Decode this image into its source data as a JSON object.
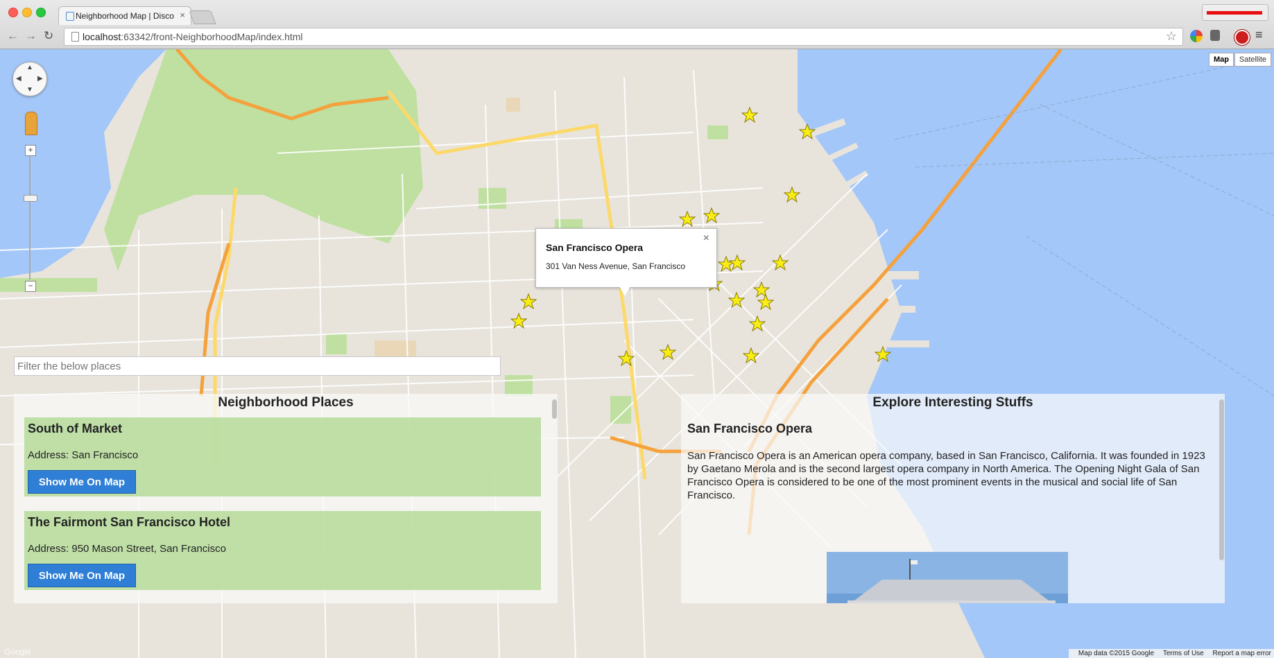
{
  "browser": {
    "tab_title": "Neighborhood Map | Disco",
    "tab_close": "×",
    "url_host": "localhost",
    "url_rest": ":63342/front-NeighborhoodMap/index.html",
    "back": "←",
    "forward": "→",
    "reload": "↻",
    "bookmark_star": "☆"
  },
  "map": {
    "type_map_label": "Map",
    "type_satellite_label": "Satellite",
    "zoom_in": "+",
    "zoom_out": "−",
    "google_logo": "Google",
    "attribution": "Map data ©2015 Google",
    "terms": "Terms of Use",
    "report": "Report a map error",
    "marker_color": "#f8ed15",
    "marker_count": 22
  },
  "info_window": {
    "title": "San Francisco Opera",
    "address": "301 Van Ness Avenue, San Francisco",
    "close": "×"
  },
  "filter": {
    "placeholder": "Filter the below places"
  },
  "places_panel": {
    "heading": "Neighborhood Places",
    "items": [
      {
        "name": "South of Market",
        "address": "Address: San Francisco",
        "button": "Show Me On Map"
      },
      {
        "name": "The Fairmont San Francisco Hotel",
        "address": "Address: 950 Mason Street, San Francisco",
        "button": "Show Me On Map"
      }
    ]
  },
  "explore_panel": {
    "heading": "Explore Interesting Stuffs",
    "title": "San Francisco Opera",
    "description": "San Francisco Opera is an American opera company, based in San Francisco, California. It was founded in 1923 by Gaetano Merola and is the second largest opera company in North America. The Opening Night Gala of San Francisco Opera is considered to be one of the most prominent events in the musical and social life of San Francisco."
  },
  "colors": {
    "water": "#a3c7f8",
    "land": "#e8e4dc",
    "park": "#bfe0a0",
    "highway": "#f5a13c",
    "button_blue": "#2f7fd6",
    "place_green": "#b0d892"
  }
}
